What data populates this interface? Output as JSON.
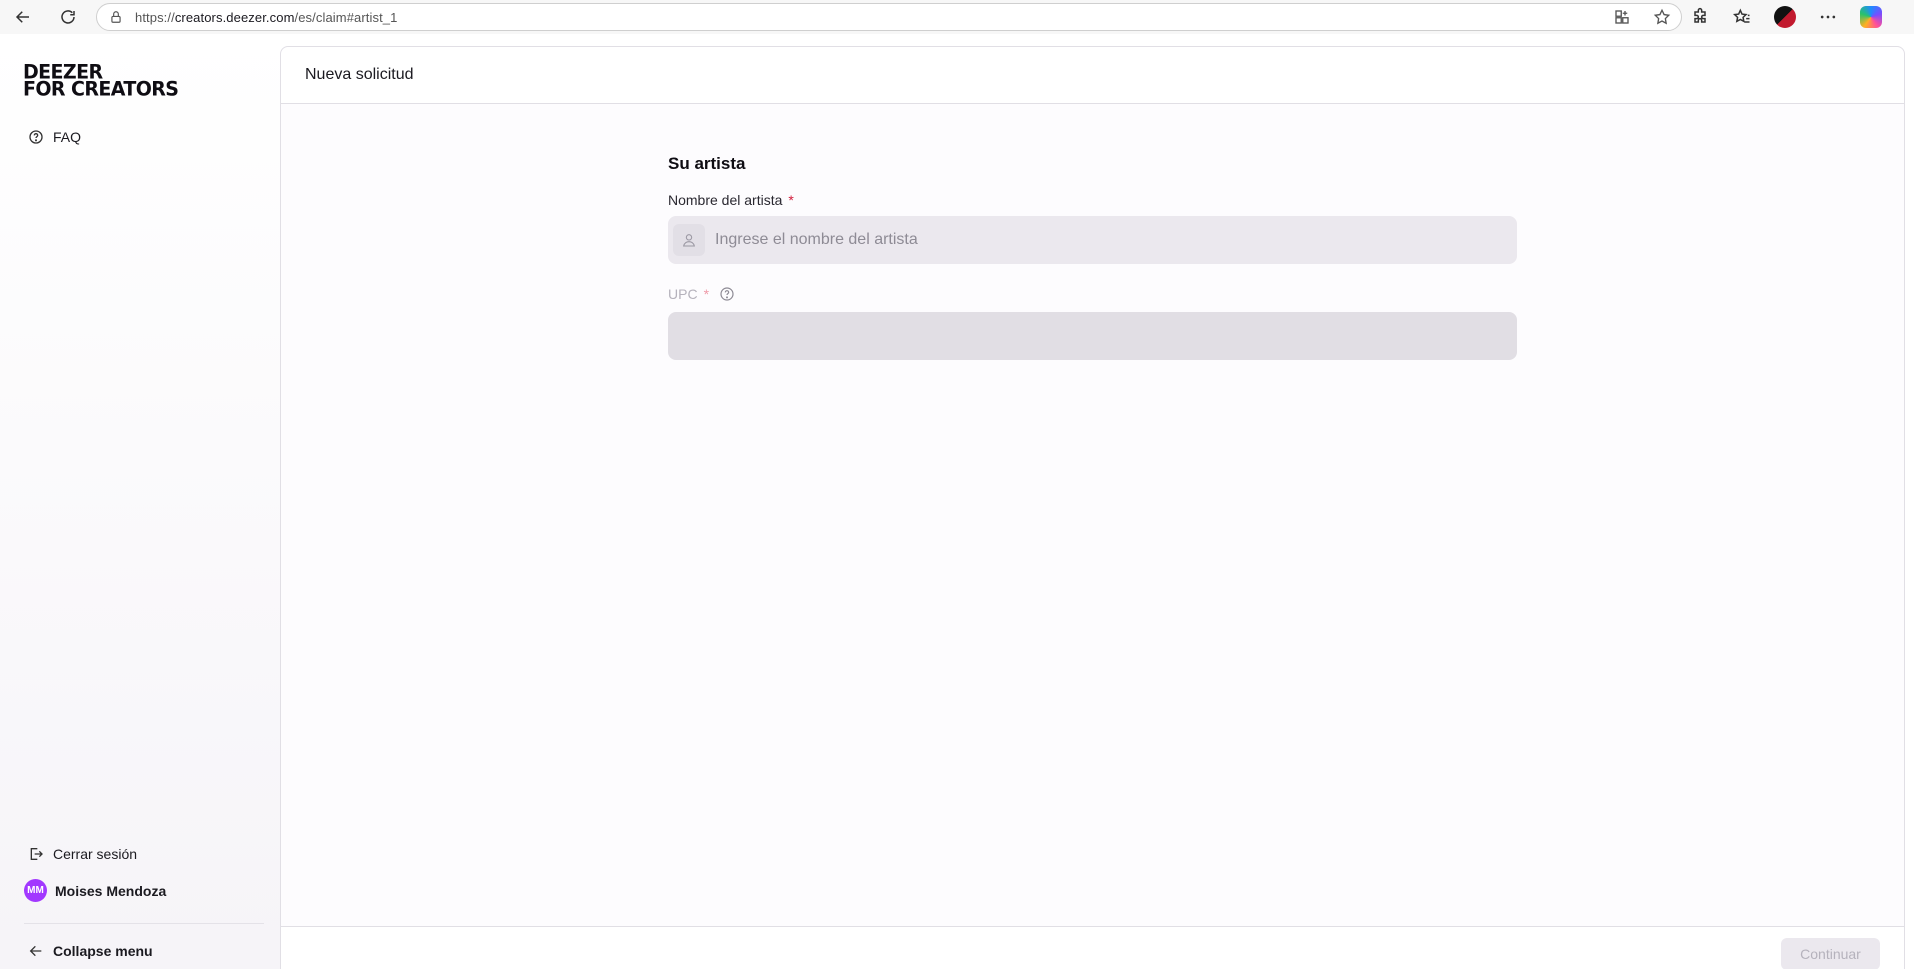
{
  "browser": {
    "url_prefix": "https://",
    "url_host": "creators.deezer.com",
    "url_path": "/es/claim#artist_1"
  },
  "sidebar": {
    "logo_line1": "DEEZER",
    "logo_line2": "FOR CREATORS",
    "faq_label": "FAQ",
    "logout_label": "Cerrar sesión",
    "user_initials": "MM",
    "user_name": "Moises Mendoza",
    "collapse_label": "Collapse menu"
  },
  "main": {
    "page_title": "Nueva solicitud",
    "section_title": "Su artista",
    "artist_field": {
      "label": "Nombre del artista",
      "required_mark": "*",
      "placeholder": "Ingrese el nombre del artista",
      "value": ""
    },
    "upc_field": {
      "label": "UPC",
      "required_mark": "*",
      "value": ""
    },
    "continue_label": "Continuar"
  },
  "colors": {
    "accent_avatar": "#a238ff",
    "required": "#d21b3a",
    "input_bg": "#ebe8ee"
  }
}
